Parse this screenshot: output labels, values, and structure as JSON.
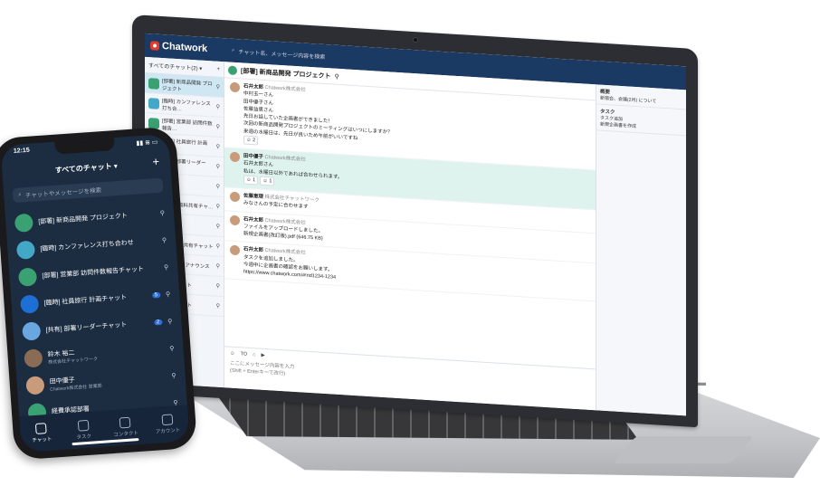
{
  "laptop": {
    "header": {
      "logo": "Chatwork",
      "search_placeholder": "チャット名、メッセージ内容を検索"
    },
    "sidebar": {
      "filter_label": "すべてのチャット(2) ▾",
      "add_label": "+",
      "rooms": [
        {
          "label": "[部署] 新商品開発 プロジェクト",
          "color": "#3aa173"
        },
        {
          "label": "[臨時] カンファレンス打ち合…",
          "color": "#43a7c8"
        },
        {
          "label": "[部署] 営業部 訪問件数報告…",
          "color": "#3aa173"
        },
        {
          "label": "[臨時] 社員旅行 計画チ…",
          "color": "#1d6fd6"
        },
        {
          "label": "[共有] 部署リーダーチ…",
          "color": "#6aa7e0"
        },
        {
          "label": "関連",
          "color": "#cccccc"
        },
        {
          "label": "会議室 資料共有チャ…",
          "color": "#cccccc"
        },
        {
          "label": "チャット",
          "color": "#cccccc"
        },
        {
          "label": "商品 販売共有チャット",
          "color": "#cccccc"
        },
        {
          "label": "共有) 全体アナウンス",
          "color": "#cccccc"
        },
        {
          "label": "確認チャット",
          "color": "#cccccc"
        },
        {
          "label": "確認チャット",
          "color": "#cccccc"
        }
      ]
    },
    "room_title": "[部署] 新商品開発 プロジェクト",
    "messages": [
      {
        "name": "石井太郎",
        "sub": "Chatwork株式会社",
        "lines": [
          "中村玉一さん",
          "田中優子さん",
          "佐藤益恵さん",
          "先日お話していた企画書ができました！",
          "次回の新商品開発プロジェクトのミーティングはいつにしますか？",
          "来週の水曜日は、先日が良いため午前がいいですね"
        ],
        "reactions": [
          "2"
        ]
      },
      {
        "name": "田中優子",
        "sub": "Chatwork株式会社",
        "lines": [
          "石井太郎さん",
          "私は、水曜日以外であれば合わせられます。"
        ],
        "reactions": [
          "1",
          "1"
        ],
        "highlight": true
      },
      {
        "name": "佐藤恵理",
        "sub": "株式会社チャットワーク",
        "lines": [
          "みなさんの予定に合わせます"
        ],
        "reactions": []
      },
      {
        "name": "石井太郎",
        "sub": "Chatwork株式会社",
        "lines": [
          "ファイルをアップロードしました。",
          "新規企画書(改訂版).pdf (646.75 KB)"
        ],
        "reactions": []
      },
      {
        "name": "石井太郎",
        "sub": "Chatwork株式会社",
        "lines": [
          "タスクを追加しました。",
          "今週中に企画書の確認をお願いします。",
          "https://www.chatwork.com/#!rid1234-1234"
        ],
        "reactions": []
      }
    ],
    "compose_placeholder": "ここにメッセージ内容を入力",
    "compose_hint": "(Shift + Enterキーで改行)",
    "right_panel": {
      "overview_title": "概要",
      "overview_text": "新宿会、会議(2月) について",
      "task_title": "タスク",
      "task_tab": "タスク追加",
      "task_item": "新規企画書を作成"
    }
  },
  "phone": {
    "time": "12:15",
    "title": "すべてのチャット ▾",
    "add_label": "+",
    "search_placeholder": "チャットやメッセージを検索",
    "rooms": [
      {
        "label": "[部署] 新商品開発 プロジェクト",
        "sub": "",
        "color": "#3aa173",
        "badge": ""
      },
      {
        "label": "[臨時] カンファレンス打ち合わせ",
        "sub": "",
        "color": "#43a7c8",
        "badge": ""
      },
      {
        "label": "[部署] 営業部 訪問件数報告チャット",
        "sub": "",
        "color": "#3aa173",
        "badge": ""
      },
      {
        "label": "[臨時] 社員旅行 計画チャット",
        "sub": "",
        "color": "#1d6fd6",
        "badge": "5"
      },
      {
        "label": "[共有] 部署リーダーチャット",
        "sub": "",
        "color": "#6aa7e0",
        "badge": "2"
      },
      {
        "label": "鈴木 裕二",
        "sub": "株式会社チャットワーク",
        "color": "#8a6c55",
        "badge": ""
      },
      {
        "label": "田中優子",
        "sub": "Chatwork株式会社 営業部",
        "color": "#c89b7b",
        "badge": ""
      },
      {
        "label": "経費承認部署",
        "sub": "",
        "color": "#3aa173",
        "badge": ""
      }
    ],
    "tabs": [
      {
        "label": "チャット",
        "active": true
      },
      {
        "label": "タスク",
        "active": false
      },
      {
        "label": "コンタクト",
        "active": false
      },
      {
        "label": "アカウント",
        "active": false
      }
    ]
  }
}
